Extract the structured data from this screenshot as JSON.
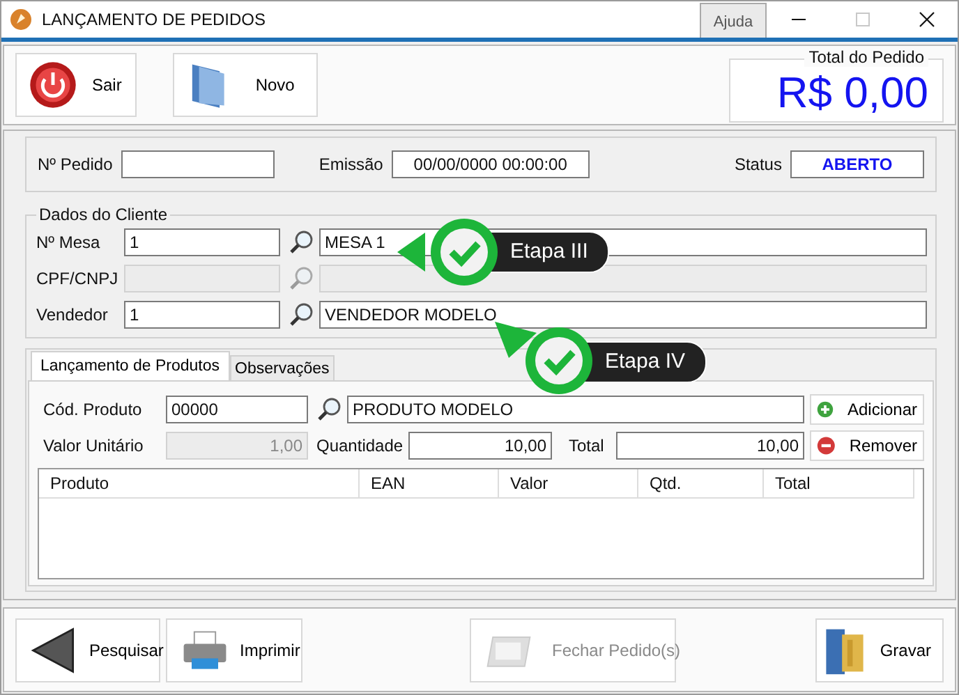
{
  "window": {
    "title": "LANÇAMENTO DE PEDIDOS",
    "help_button": "Ajuda",
    "maximize_disabled": true
  },
  "toolbar": [
    {
      "label": "Sair"
    },
    {
      "label": "Novo"
    }
  ],
  "total": {
    "label": "Total do Pedido",
    "value": "R$ 0,00"
  },
  "order": {
    "number_label": "Nº Pedido",
    "emission_label": "Emissão",
    "emission": "00/00/0000 00:00:00",
    "status_label": "Status",
    "status": "ABERTO"
  },
  "client": {
    "title": "Dados do Cliente",
    "rows": [
      {
        "label": "Nº Mesa",
        "code": "1",
        "name": "MESA 1",
        "disabled": false
      },
      {
        "label": "CPF/CNPJ",
        "disabled": true
      },
      {
        "label": "Vendedor",
        "code": "1",
        "name": "VENDEDOR MODELO",
        "disabled": false
      }
    ]
  },
  "tabs": [
    {
      "label": "Lançamento de Produtos",
      "selected": true
    },
    {
      "label": "Observações",
      "selected": false
    }
  ],
  "product": {
    "code_label": "Cód. Produto",
    "code": "00000",
    "name": "PRODUTO MODELO",
    "unit_label": "Valor Unitário",
    "unit": "1,00",
    "qty_label": "Quantidade",
    "qty": "10,00",
    "total_label": "Total",
    "total": "10,00",
    "add": "Adicionar",
    "remove": "Remover"
  },
  "table": {
    "columns": [
      "Produto",
      "EAN",
      "Valor",
      "Qtd.",
      "Total"
    ]
  },
  "footer_buttons": [
    {
      "label": "Pesquisar",
      "disabled": false
    },
    {
      "label": "Imprimir",
      "disabled": false
    },
    {
      "label": "Fechar Pedido(s)",
      "disabled": true
    },
    {
      "label": "Gravar",
      "disabled": false
    }
  ],
  "callouts": [
    {
      "label": "Etapa III"
    },
    {
      "label": "Etapa IV"
    }
  ]
}
